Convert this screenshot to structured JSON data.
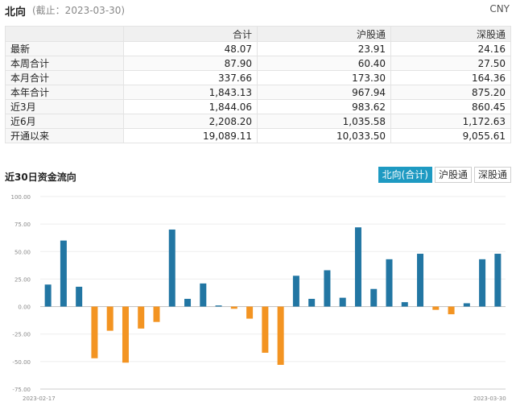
{
  "header": {
    "title": "北向",
    "date_note": "(截止：2023-03-30)",
    "currency": "CNY"
  },
  "table": {
    "columns": [
      "",
      "合计",
      "沪股通",
      "深股通"
    ],
    "rows": [
      {
        "label": "最新",
        "values": [
          "48.07",
          "23.91",
          "24.16"
        ]
      },
      {
        "label": "本周合计",
        "values": [
          "87.90",
          "60.40",
          "27.50"
        ]
      },
      {
        "label": "本月合计",
        "values": [
          "337.66",
          "173.30",
          "164.36"
        ]
      },
      {
        "label": "本年合计",
        "values": [
          "1,843.13",
          "967.94",
          "875.20"
        ]
      },
      {
        "label": "近3月",
        "values": [
          "1,844.06",
          "983.62",
          "860.45"
        ]
      },
      {
        "label": "近6月",
        "values": [
          "2,208.20",
          "1,035.58",
          "1,172.63"
        ]
      },
      {
        "label": "开通以来",
        "values": [
          "19,089.11",
          "10,033.50",
          "9,055.61"
        ]
      }
    ]
  },
  "section": {
    "title": "近30日资金流向",
    "tabs": [
      {
        "label": "北向(合计)",
        "active": true
      },
      {
        "label": "沪股通",
        "active": false
      },
      {
        "label": "深股通",
        "active": false
      }
    ]
  },
  "chart_data": {
    "type": "bar",
    "ylim": [
      -75,
      100
    ],
    "y_ticks": [
      "100.00",
      "75.00",
      "50.00",
      "25.00",
      "0.00",
      "-25.00",
      "-50.00",
      "-75.00"
    ],
    "x_start_label": "2023-02-17",
    "x_end_label": "2023-03-30",
    "positive_color": "#2276a3",
    "negative_color": "#f39422",
    "values": [
      20,
      60,
      18,
      -47,
      -22,
      -51,
      -20,
      -14,
      70,
      7,
      21,
      1,
      -2,
      -11,
      -42,
      -53,
      28,
      7,
      33,
      8,
      72,
      16,
      43,
      4,
      48,
      -3,
      -7,
      3,
      43,
      48
    ]
  }
}
